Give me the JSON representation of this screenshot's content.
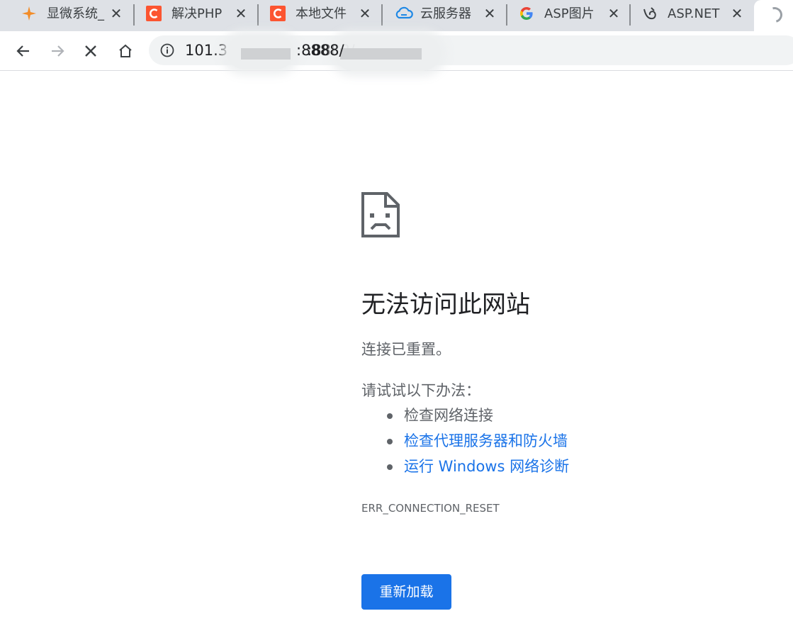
{
  "tabs": [
    {
      "title": "显微系统_",
      "favicon": "star-icon",
      "favicon_color": "#f28c28"
    },
    {
      "title": "解决PHP",
      "favicon": "csdn-c-icon",
      "favicon_color": "#fc5531"
    },
    {
      "title": "本地文件",
      "favicon": "csdn-c-icon",
      "favicon_color": "#fc5531"
    },
    {
      "title": "云服务器",
      "favicon": "cloud-icon",
      "favicon_color": "#1e88e5"
    },
    {
      "title": "ASP图片",
      "favicon": "google-g-icon",
      "favicon_color": "#4285f4"
    },
    {
      "title": "ASP.NET",
      "favicon": "dojo-icon",
      "favicon_color": "#3c4043"
    }
  ],
  "active_tab": {
    "state": "loading",
    "favicon": "spinner-icon"
  },
  "toolbar": {
    "url_prefix": "101.3",
    "url_port": ":8888/"
  },
  "error_page": {
    "heading": "无法访问此网站",
    "summary": "连接已重置。",
    "suggestions_title": "请试试以下办法：",
    "suggestions": [
      {
        "text": "检查网络连接",
        "is_link": false
      },
      {
        "text": "检查代理服务器和防火墙",
        "is_link": true
      },
      {
        "text": "运行 Windows 网络诊断",
        "is_link": true
      }
    ],
    "error_code": "ERR_CONNECTION_RESET",
    "reload_label": "重新加载"
  },
  "colors": {
    "link": "#1a73e8",
    "button": "#1a73e8",
    "tabstrip": "#dee1e6",
    "omnibox": "#f1f3f4",
    "body_text": "#5f6368"
  }
}
